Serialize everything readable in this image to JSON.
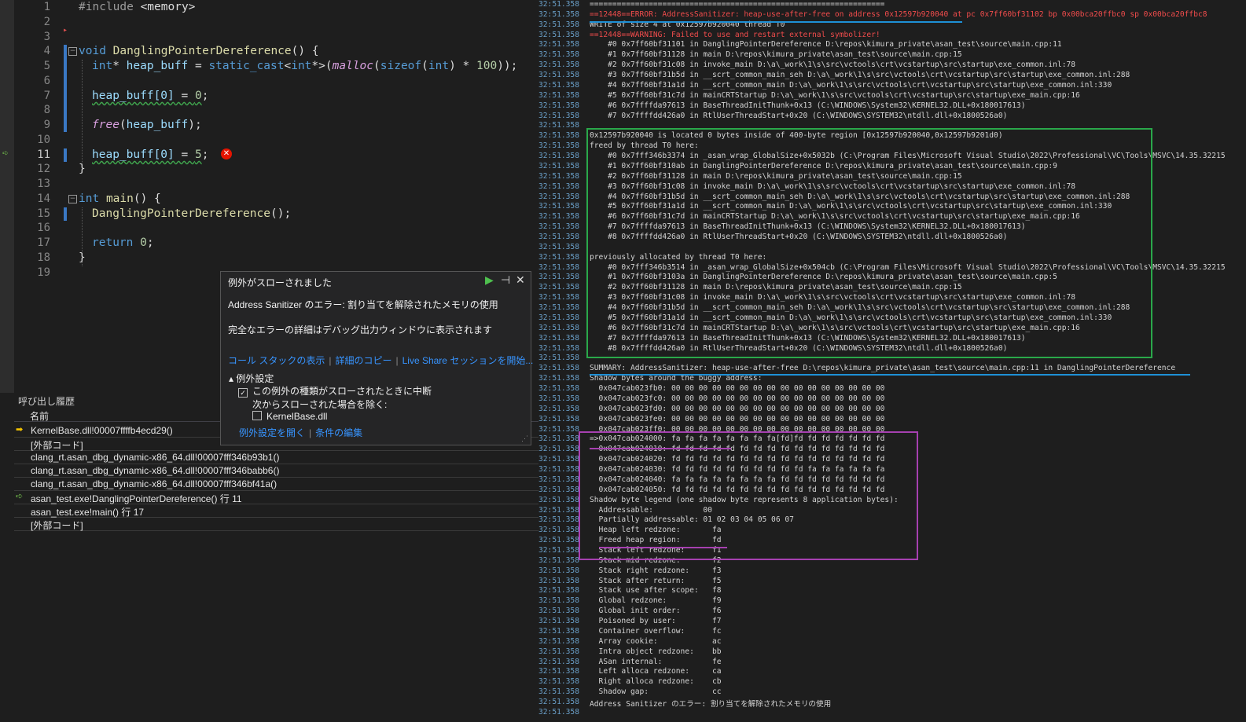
{
  "editor": {
    "line_numbers": [
      "1",
      "2",
      "3",
      "4",
      "5",
      "6",
      "7",
      "8",
      "9",
      "10",
      "11",
      "12",
      "13",
      "14",
      "15",
      "16",
      "17",
      "18",
      "19"
    ],
    "current_line": "11",
    "lines": {
      "l1_pp": "#include",
      "l1_hdr": " <memory>",
      "l4_kw": "void",
      "l4_fn": "DanglingPointerDereference",
      "l4_rest": "() {",
      "l5_kw": "int",
      "l5_star": "* ",
      "l5_var": "heap_buff",
      "l5_eq": " = ",
      "l5_cast": "static_cast",
      "l5_lt": "<",
      "l5_kw2": "int",
      "l5_gt": "*>(",
      "l5_mac": "malloc",
      "l5_p": "(",
      "l5_sizeof": "sizeof",
      "l5_p2": "(",
      "l5_int": "int",
      "l5_p3": ") * ",
      "l5_num": "100",
      "l5_end": "));",
      "l7_expr": "heap_buff[0]",
      "l7_rest": " = ",
      "l7_num": "0",
      "l7_end": ";",
      "l9_mac": "free",
      "l9_rest": "(",
      "l9_var": "heap_buff",
      "l9_end": ");",
      "l11_expr": "heap_buff[0]",
      "l11_rest": " = ",
      "l11_num": "5",
      "l11_end": ";",
      "l12": "}",
      "l14_kw": "int",
      "l14_fn": "main",
      "l14_rest": "() {",
      "l15_fn": "DanglingPointerDereference",
      "l15_rest": "();",
      "l17_kw": "return",
      "l17_num": "0",
      "l17_end": ";",
      "l18": "}"
    }
  },
  "exception_popup": {
    "title": "例外がスローされました",
    "message": "Address Sanitizer のエラー: 割り当てを解除されたメモリの使用",
    "detail": "完全なエラーの詳細はデバッグ出力ウィンドウに表示されます",
    "link_callstack": "コール スタックの表示",
    "link_copy": "詳細のコピー",
    "link_liveshare": "Live Share セッションを開始...",
    "settings_header": "例外設定",
    "break_checkbox": "この例外の種類がスローされたときに中断",
    "except_label": "次からスローされた場合を除く:",
    "kernelbase_checkbox": "KernelBase.dll",
    "link_open_settings": "例外設定を開く",
    "link_edit_conditions": "条件の編集"
  },
  "callstack": {
    "title": "呼び出し履歴",
    "col_name": "名前",
    "rows": [
      "KernelBase.dll!00007ffffb4ecd29()",
      "[外部コード]",
      "clang_rt.asan_dbg_dynamic-x86_64.dll!00007fff346b93b1()",
      "clang_rt.asan_dbg_dynamic-x86_64.dll!00007fff346babb6()",
      "clang_rt.asan_dbg_dynamic-x86_64.dll!00007fff346bf41a()",
      "asan_test.exe!DanglingPointerDereference() 行 11",
      "asan_test.exe!main() 行 17",
      "[外部コード]"
    ]
  },
  "output": {
    "timestamp": "32:51.358",
    "lines": [
      "=================================================================",
      "==12448==ERROR: AddressSanitizer: heap-use-after-free on address 0x12597b920040 at pc 0x7ff60bf31102 bp 0x00bca20ffbc0 sp 0x00bca20ffbc8",
      "WRITE of size 4 at 0x12597b920040 thread T0",
      "==12448==WARNING: Failed to use and restart external symbolizer!",
      "    #0 0x7ff60bf31101 in DanglingPointerDereference D:\\repos\\kimura_private\\asan_test\\source\\main.cpp:11",
      "    #1 0x7ff60bf31128 in main D:\\repos\\kimura_private\\asan_test\\source\\main.cpp:15",
      "    #2 0x7ff60bf31c08 in invoke_main D:\\a\\_work\\1\\s\\src\\vctools\\crt\\vcstartup\\src\\startup\\exe_common.inl:78",
      "    #3 0x7ff60bf31b5d in __scrt_common_main_seh D:\\a\\_work\\1\\s\\src\\vctools\\crt\\vcstartup\\src\\startup\\exe_common.inl:288",
      "    #4 0x7ff60bf31a1d in __scrt_common_main D:\\a\\_work\\1\\s\\src\\vctools\\crt\\vcstartup\\src\\startup\\exe_common.inl:330",
      "    #5 0x7ff60bf31c7d in mainCRTStartup D:\\a\\_work\\1\\s\\src\\vctools\\crt\\vcstartup\\src\\startup\\exe_main.cpp:16",
      "    #6 0x7ffffda97613 in BaseThreadInitThunk+0x13 (C:\\WINDOWS\\System32\\KERNEL32.DLL+0x180017613)",
      "    #7 0x7ffffdd426a0 in RtlUserThreadStart+0x20 (C:\\WINDOWS\\SYSTEM32\\ntdll.dll+0x1800526a0)",
      "",
      "0x12597b920040 is located 0 bytes inside of 400-byte region [0x12597b920040,0x12597b9201d0)",
      "freed by thread T0 here:",
      "    #0 0x7fff346b3374 in _asan_wrap_GlobalSize+0x5032b (C:\\Program Files\\Microsoft Visual Studio\\2022\\Professional\\VC\\Tools\\MSVC\\14.35.32215",
      "    #1 0x7ff60bf310ab in DanglingPointerDereference D:\\repos\\kimura_private\\asan_test\\source\\main.cpp:9",
      "    #2 0x7ff60bf31128 in main D:\\repos\\kimura_private\\asan_test\\source\\main.cpp:15",
      "    #3 0x7ff60bf31c08 in invoke_main D:\\a\\_work\\1\\s\\src\\vctools\\crt\\vcstartup\\src\\startup\\exe_common.inl:78",
      "    #4 0x7ff60bf31b5d in __scrt_common_main_seh D:\\a\\_work\\1\\s\\src\\vctools\\crt\\vcstartup\\src\\startup\\exe_common.inl:288",
      "    #5 0x7ff60bf31a1d in __scrt_common_main D:\\a\\_work\\1\\s\\src\\vctools\\crt\\vcstartup\\src\\startup\\exe_common.inl:330",
      "    #6 0x7ff60bf31c7d in mainCRTStartup D:\\a\\_work\\1\\s\\src\\vctools\\crt\\vcstartup\\src\\startup\\exe_main.cpp:16",
      "    #7 0x7ffffda97613 in BaseThreadInitThunk+0x13 (C:\\WINDOWS\\System32\\KERNEL32.DLL+0x180017613)",
      "    #8 0x7ffffdd426a0 in RtlUserThreadStart+0x20 (C:\\WINDOWS\\SYSTEM32\\ntdll.dll+0x1800526a0)",
      "",
      "previously allocated by thread T0 here:",
      "    #0 0x7fff346b3514 in _asan_wrap_GlobalSize+0x504cb (C:\\Program Files\\Microsoft Visual Studio\\2022\\Professional\\VC\\Tools\\MSVC\\14.35.32215",
      "    #1 0x7ff60bf3103a in DanglingPointerDereference D:\\repos\\kimura_private\\asan_test\\source\\main.cpp:5",
      "    #2 0x7ff60bf31128 in main D:\\repos\\kimura_private\\asan_test\\source\\main.cpp:15",
      "    #3 0x7ff60bf31c08 in invoke_main D:\\a\\_work\\1\\s\\src\\vctools\\crt\\vcstartup\\src\\startup\\exe_common.inl:78",
      "    #4 0x7ff60bf31b5d in __scrt_common_main_seh D:\\a\\_work\\1\\s\\src\\vctools\\crt\\vcstartup\\src\\startup\\exe_common.inl:288",
      "    #5 0x7ff60bf31a1d in __scrt_common_main D:\\a\\_work\\1\\s\\src\\vctools\\crt\\vcstartup\\src\\startup\\exe_common.inl:330",
      "    #6 0x7ff60bf31c7d in mainCRTStartup D:\\a\\_work\\1\\s\\src\\vctools\\crt\\vcstartup\\src\\startup\\exe_main.cpp:16",
      "    #7 0x7ffffda97613 in BaseThreadInitThunk+0x13 (C:\\WINDOWS\\System32\\KERNEL32.DLL+0x180017613)",
      "    #8 0x7ffffdd426a0 in RtlUserThreadStart+0x20 (C:\\WINDOWS\\SYSTEM32\\ntdll.dll+0x1800526a0)",
      "",
      "SUMMARY: AddressSanitizer: heap-use-after-free D:\\repos\\kimura_private\\asan_test\\source\\main.cpp:11 in DanglingPointerDereference",
      "Shadow bytes around the buggy address:",
      "  0x047cab023fb0: 00 00 00 00 00 00 00 00 00 00 00 00 00 00 00 00",
      "  0x047cab023fc0: 00 00 00 00 00 00 00 00 00 00 00 00 00 00 00 00",
      "  0x047cab023fd0: 00 00 00 00 00 00 00 00 00 00 00 00 00 00 00 00",
      "  0x047cab023fe0: 00 00 00 00 00 00 00 00 00 00 00 00 00 00 00 00",
      "  0x047cab023ff0: 00 00 00 00 00 00 00 00 00 00 00 00 00 00 00 00",
      "=>0x047cab024000: fa fa fa fa fa fa fa fa[fd]fd fd fd fd fd fd fd",
      "  0x047cab024010: fd fd fd fd fd fd fd fd fd fd fd fd fd fd fd fd",
      "  0x047cab024020: fd fd fd fd fd fd fd fd fd fd fd fd fd fd fd fd",
      "  0x047cab024030: fd fd fd fd fd fd fd fd fd fd fa fa fa fa fa fa",
      "  0x047cab024040: fa fa fa fa fa fa fa fa fd fd fd fd fd fd fd fd",
      "  0x047cab024050: fd fd fd fd fd fd fd fd fd fd fd fd fd fd fd fd",
      "Shadow byte legend (one shadow byte represents 8 application bytes):",
      "  Addressable:           00",
      "  Partially addressable: 01 02 03 04 05 06 07",
      "  Heap left redzone:       fa",
      "  Freed heap region:       fd",
      "  Stack left redzone:      f1",
      "  Stack mid redzone:       f2",
      "  Stack right redzone:     f3",
      "  Stack after return:      f5",
      "  Stack use after scope:   f8",
      "  Global redzone:          f9",
      "  Global init order:       f6",
      "  Poisoned by user:        f7",
      "  Container overflow:      fc",
      "  Array cookie:            ac",
      "  Intra object redzone:    bb",
      "  ASan internal:           fe",
      "  Left alloca redzone:     ca",
      "  Right alloca redzone:    cb",
      "  Shadow gap:              cc",
      "Address Sanitizer のエラー: 割り当てを解除されたメモリの使用",
      ""
    ]
  },
  "colors": {
    "box_green": "#2aa84a",
    "underline_blue": "#1e90d6",
    "box_purple": "#a640b0",
    "error_red": "#f14c4c"
  }
}
